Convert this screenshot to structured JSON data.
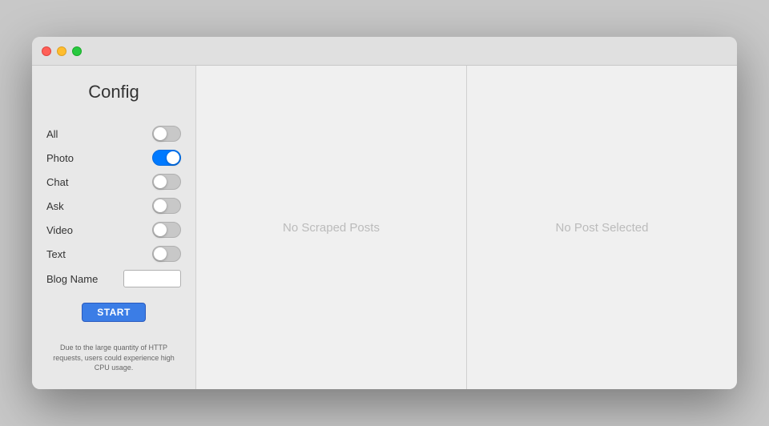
{
  "window": {
    "title": "Config"
  },
  "traffic_lights": {
    "close_label": "close",
    "minimize_label": "minimize",
    "maximize_label": "maximize"
  },
  "sidebar": {
    "title": "Config",
    "toggles": [
      {
        "label": "All",
        "state": "off"
      },
      {
        "label": "Photo",
        "state": "on"
      },
      {
        "label": "Chat",
        "state": "off"
      },
      {
        "label": "Ask",
        "state": "off"
      },
      {
        "label": "Video",
        "state": "off"
      },
      {
        "label": "Text",
        "state": "off"
      }
    ],
    "blog_name_label": "Blog Name",
    "blog_name_placeholder": "",
    "blog_name_value": "",
    "start_button_label": "START",
    "warning_text": "Due to the large quantity of HTTP requests, users could experience high CPU usage."
  },
  "middle_panel": {
    "empty_text": "No Scraped Posts"
  },
  "right_panel": {
    "empty_text": "No Post Selected"
  }
}
